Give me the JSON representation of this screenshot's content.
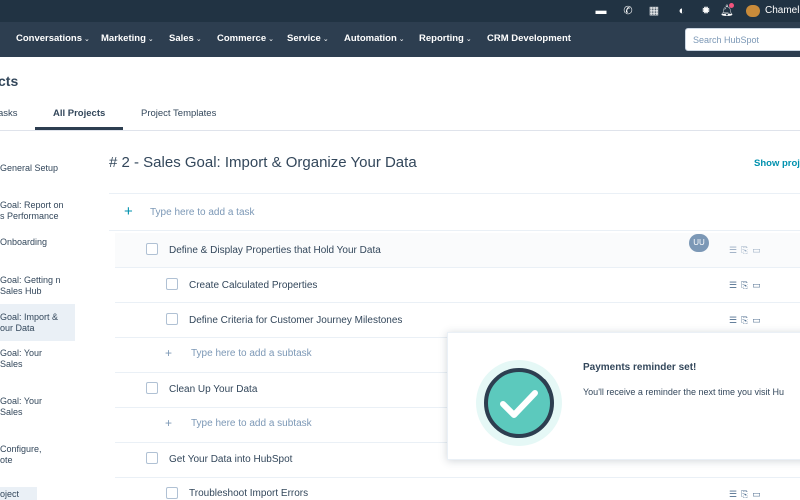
{
  "topbar": {
    "account_name": "Chameleon",
    "icons": [
      "marketplace-icon",
      "calling-icon",
      "app-store-icon",
      "help-icon",
      "settings-icon",
      "notifications-icon"
    ]
  },
  "nav": {
    "items": [
      {
        "label": "Conversations"
      },
      {
        "label": "Marketing"
      },
      {
        "label": "Sales"
      },
      {
        "label": "Commerce"
      },
      {
        "label": "Service"
      },
      {
        "label": "Automation"
      },
      {
        "label": "Reporting"
      },
      {
        "label": "CRM Development"
      }
    ],
    "chevron": "⌄",
    "search_placeholder": "Search HubSpot"
  },
  "page": {
    "title": "cts",
    "tabs": [
      {
        "label": "asks"
      },
      {
        "label": "All Projects"
      },
      {
        "label": "Project Templates"
      }
    ]
  },
  "sidebar": {
    "items": [
      {
        "label": "General Setup"
      },
      {
        "label": "Goal: Report on s Performance"
      },
      {
        "label": "Onboarding"
      },
      {
        "label": "Goal: Getting n Sales Hub"
      },
      {
        "label": "Goal: Import & our Data"
      },
      {
        "label": "Goal: Your Sales"
      },
      {
        "label": "Goal: Your Sales"
      },
      {
        "label": "Configure, ote"
      },
      {
        "label": "oject"
      }
    ]
  },
  "project": {
    "title": "# 2 - Sales Goal: Import & Organize Your Data",
    "show_project_label": "Show proj",
    "add_task_placeholder": "Type here to add a task",
    "assignee_initials": "UU",
    "tasks": [
      {
        "label": "Define & Display Properties that Hold Your Data"
      },
      {
        "label": "Create Calculated Properties"
      },
      {
        "label": "Define Criteria for Customer Journey Milestones"
      },
      {
        "label": "Type here to add a subtask"
      },
      {
        "label": "Clean Up Your Data"
      },
      {
        "label": "Type here to add a subtask"
      },
      {
        "label": "Get Your Data into HubSpot"
      },
      {
        "label": "Troubleshoot Import Errors"
      }
    ]
  },
  "toast": {
    "title": "Payments reminder set!",
    "body": "You'll receive a reminder the next time you visit Hu"
  },
  "colors": {
    "topbar": "#213343",
    "nav": "#2d3e50",
    "accent": "#0091ae",
    "toast_icon": "#5cc9bd"
  }
}
